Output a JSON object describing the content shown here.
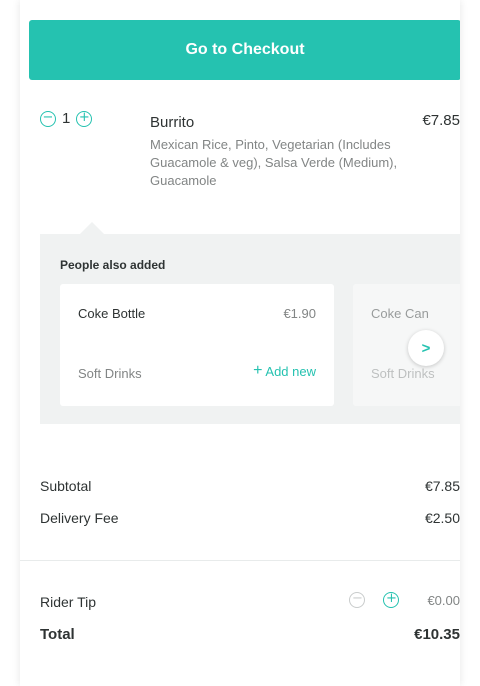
{
  "checkout": {
    "label": "Go to Checkout"
  },
  "item": {
    "quantity": "1",
    "name": "Burrito",
    "description": "Mexican Rice, Pinto, Vegetarian (Includes Guacamole & veg), Salsa Verde (Medium), Guacamole",
    "price": "€7.85",
    "decrease_symbol": "−",
    "increase_symbol": "+"
  },
  "also_added": {
    "title": "People also added",
    "cards": [
      {
        "name": "Coke Bottle",
        "price": "€1.90",
        "category": "Soft Drinks",
        "add_label": "Add new"
      },
      {
        "name": "Coke Can",
        "category": "Soft Drinks"
      }
    ],
    "next_symbol": ">"
  },
  "summary": {
    "subtotal_label": "Subtotal",
    "subtotal_value": "€7.85",
    "delivery_label": "Delivery Fee",
    "delivery_value": "€2.50",
    "tip_label": "Rider Tip",
    "tip_value": "€0.00",
    "total_label": "Total",
    "total_value": "€10.35"
  },
  "colors": {
    "accent": "#25c2b0",
    "text": "#2e3333",
    "muted": "#828585",
    "section_bg": "#f0f2f2"
  }
}
